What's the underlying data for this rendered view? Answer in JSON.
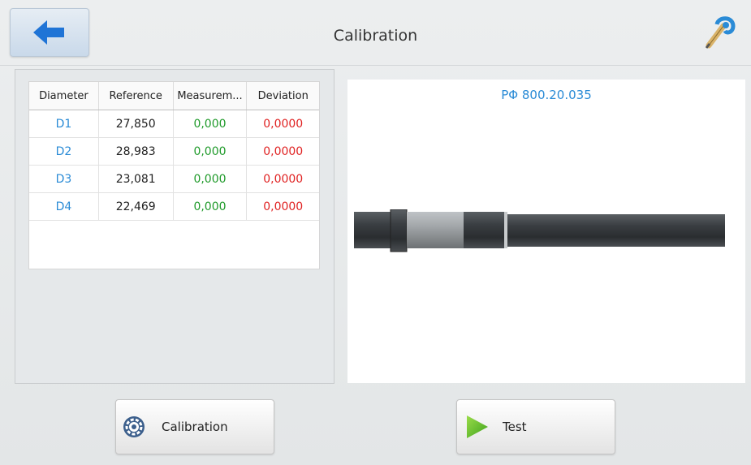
{
  "header": {
    "title": "Calibration",
    "back_icon": "arrow-left-icon",
    "tool_icon": "micrometer-icon"
  },
  "table": {
    "columns": [
      "Diameter",
      "Reference",
      "Measurem...",
      "Deviation"
    ],
    "rows": [
      {
        "diameter": "D1",
        "reference": "27,850",
        "measurement": "0,000",
        "deviation": "0,0000"
      },
      {
        "diameter": "D2",
        "reference": "28,983",
        "measurement": "0,000",
        "deviation": "0,0000"
      },
      {
        "diameter": "D3",
        "reference": "23,081",
        "measurement": "0,000",
        "deviation": "0,0000"
      },
      {
        "diameter": "D4",
        "reference": "22,469",
        "measurement": "0,000",
        "deviation": "0,0000"
      }
    ]
  },
  "preview": {
    "part_label": "РΦ 800.20.035"
  },
  "buttons": {
    "calibration_label": "Calibration",
    "test_label": "Test"
  },
  "colors": {
    "diameter": "#2a8bd6",
    "measurement": "#1f9a2a",
    "deviation": "#e02222",
    "accent": "#1f74d6"
  }
}
